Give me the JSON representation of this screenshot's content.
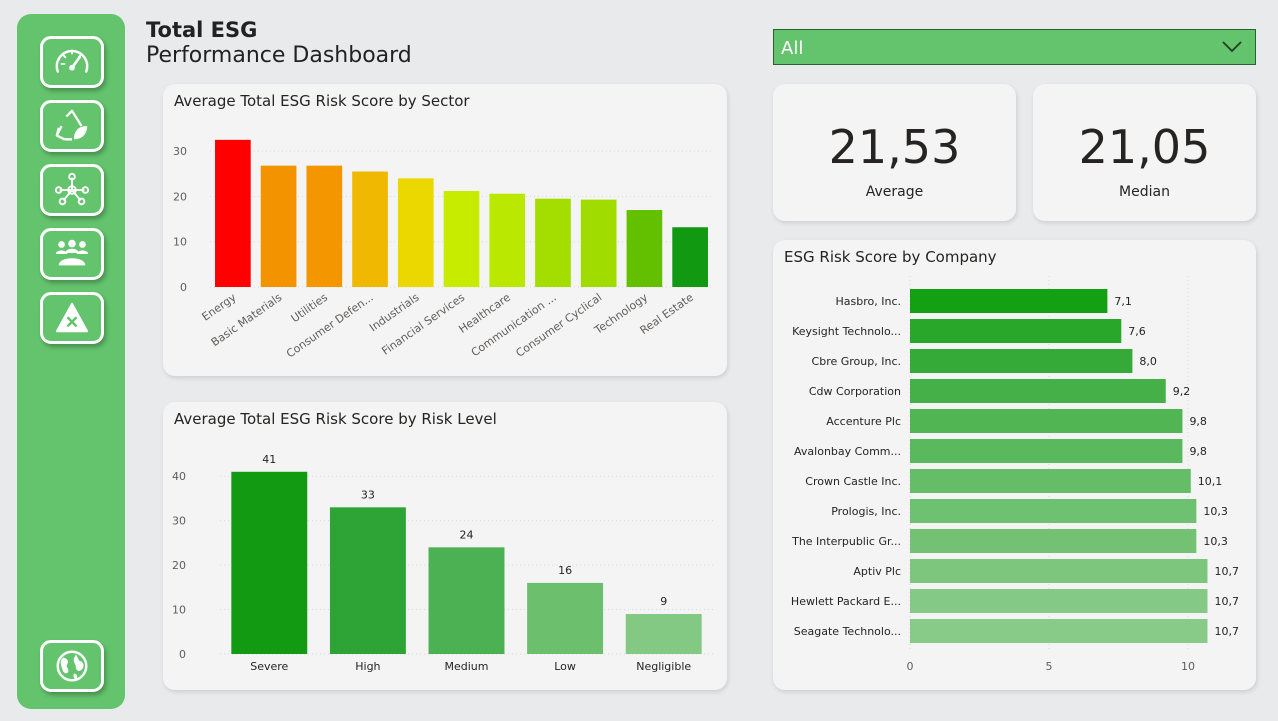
{
  "header": {
    "title_bold": "Total ESG",
    "title_sub": "Performance Dashboard"
  },
  "sidebar": {
    "items": [
      {
        "name": "gauge-icon"
      },
      {
        "name": "recycle-leaf-icon"
      },
      {
        "name": "network-icon"
      },
      {
        "name": "people-icon"
      },
      {
        "name": "warning-icon"
      },
      {
        "name": "globe-icon"
      }
    ]
  },
  "filter": {
    "value": "All"
  },
  "kpis": {
    "average": {
      "value": "21,53",
      "label": "Average"
    },
    "median": {
      "value": "21,05",
      "label": "Median"
    }
  },
  "colors": {
    "sidebar": "#64c46d",
    "card": "#f4f4f4",
    "page": "#e9eaec"
  },
  "chart_data": [
    {
      "id": "sector",
      "type": "bar",
      "title": "Average Total ESG Risk Score by Sector",
      "categories": [
        "Energy",
        "Basic Materials",
        "Utilities",
        "Consumer Defen...",
        "Industrials",
        "Financial Services",
        "Healthcare",
        "Communication ...",
        "Consumer Cyclical",
        "Technology",
        "Real Estate"
      ],
      "values": [
        32.5,
        26.8,
        26.8,
        25.5,
        24.0,
        21.2,
        20.6,
        19.5,
        19.3,
        17.0,
        13.2
      ],
      "colors": [
        "#fe0000",
        "#f39300",
        "#f39600",
        "#f0b800",
        "#ebd800",
        "#c8ec00",
        "#bbe800",
        "#a4dd00",
        "#a1dc00",
        "#62c000",
        "#119911"
      ],
      "ylim": [
        0,
        36
      ],
      "yticks": [
        0,
        10,
        20,
        30
      ]
    },
    {
      "id": "risk",
      "type": "bar",
      "title": "Average Total ESG Risk Score by Risk Level",
      "categories": [
        "Severe",
        "High",
        "Medium",
        "Low",
        "Negligible"
      ],
      "values": [
        41,
        33,
        24,
        16,
        9
      ],
      "labels": [
        "41",
        "33",
        "24",
        "16",
        "9"
      ],
      "colors": [
        "#139a13",
        "#2ea336",
        "#4cb152",
        "#6bbf6d",
        "#83c984"
      ],
      "ylim": [
        0,
        45
      ],
      "yticks": [
        0,
        10,
        20,
        30,
        40
      ]
    },
    {
      "id": "company",
      "type": "bar",
      "orientation": "horizontal",
      "title": "ESG Risk Score by Company",
      "categories": [
        "Hasbro, Inc.",
        "Keysight Technolo...",
        "Cbre Group, Inc.",
        "Cdw Corporation",
        "Accenture Plc",
        "Avalonbay Comm...",
        "Crown Castle Inc.",
        "Prologis, Inc.",
        "The Interpublic Gr...",
        "Aptiv Plc",
        "Hewlett Packard E...",
        "Seagate Technolo..."
      ],
      "values": [
        7.1,
        7.6,
        8.0,
        9.2,
        9.8,
        9.8,
        10.1,
        10.3,
        10.3,
        10.7,
        10.7,
        10.7
      ],
      "labels": [
        "7,1",
        "7,6",
        "8,0",
        "9,2",
        "9,8",
        "9,8",
        "10,1",
        "10,3",
        "10,3",
        "10,7",
        "10,7",
        "10,7"
      ],
      "colors": [
        "#13a013",
        "#28a72b",
        "#35aa38",
        "#45b048",
        "#52b554",
        "#5ab95c",
        "#66bd68",
        "#6ec170",
        "#73c274",
        "#7cc67d",
        "#84c985",
        "#88cb89"
      ],
      "xlim": [
        0,
        12
      ],
      "xticks": [
        0,
        5,
        10
      ]
    }
  ]
}
